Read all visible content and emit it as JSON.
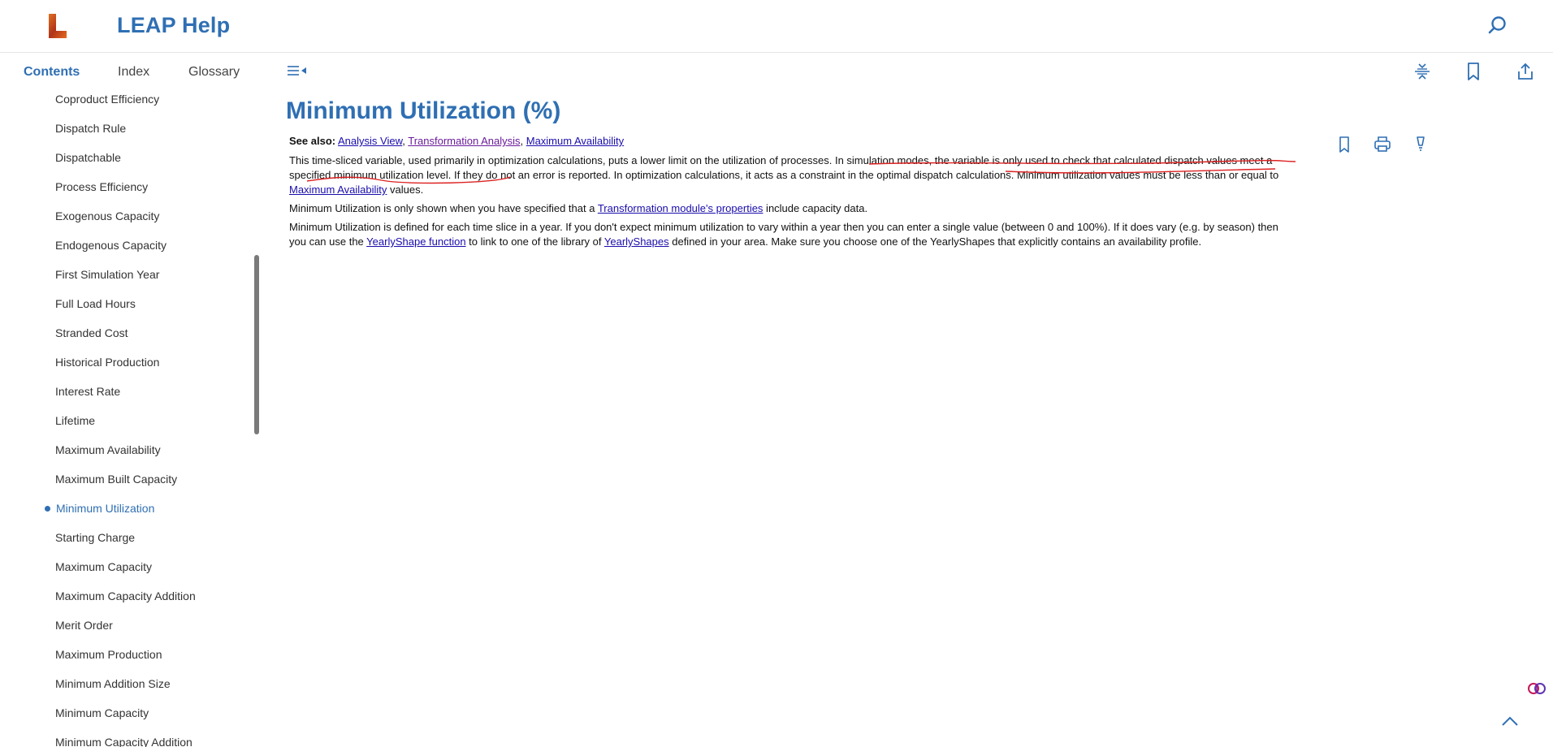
{
  "header": {
    "app_title": "LEAP Help",
    "logo_icon": "leap-logo",
    "search_icon": "search-icon",
    "accent_color": "#2f6fb3"
  },
  "tabs": [
    {
      "label": "Contents",
      "active": true
    },
    {
      "label": "Index",
      "active": false
    },
    {
      "label": "Glossary",
      "active": false
    }
  ],
  "toolbar": {
    "collapse_icon": "sidebar-collapse-icon",
    "icons": [
      "collapse-sections-icon",
      "bookmark-icon",
      "share-icon"
    ]
  },
  "sidebar": {
    "items": [
      {
        "label": "Coproduct Efficiency",
        "active": false
      },
      {
        "label": "Dispatch Rule",
        "active": false
      },
      {
        "label": "Dispatchable",
        "active": false
      },
      {
        "label": "Process Efficiency",
        "active": false
      },
      {
        "label": "Exogenous Capacity",
        "active": false
      },
      {
        "label": "Endogenous Capacity",
        "active": false
      },
      {
        "label": "First Simulation Year",
        "active": false
      },
      {
        "label": "Full Load Hours",
        "active": false
      },
      {
        "label": "Stranded Cost",
        "active": false
      },
      {
        "label": "Historical Production",
        "active": false
      },
      {
        "label": "Interest Rate",
        "active": false
      },
      {
        "label": "Lifetime",
        "active": false
      },
      {
        "label": "Maximum Availability",
        "active": false
      },
      {
        "label": "Maximum Built Capacity",
        "active": false
      },
      {
        "label": "Minimum Utilization",
        "active": true
      },
      {
        "label": "Starting Charge",
        "active": false
      },
      {
        "label": "Maximum Capacity",
        "active": false
      },
      {
        "label": "Maximum Capacity Addition",
        "active": false
      },
      {
        "label": "Merit Order",
        "active": false
      },
      {
        "label": "Maximum Production",
        "active": false
      },
      {
        "label": "Minimum Addition Size",
        "active": false
      },
      {
        "label": "Minimum Capacity",
        "active": false
      },
      {
        "label": "Minimum Capacity Addition",
        "active": false
      }
    ]
  },
  "main": {
    "title": "Minimum Utilization (%)",
    "see_also_label": "See also:",
    "see_also_links": [
      "Analysis View",
      "Transformation Analysis",
      "Maximum Availability"
    ],
    "p1": {
      "a": "This time-sliced variable, used primarily in optimization calculations, puts a lower limit on the utilization of processes.   ",
      "highlight": "In simulation modes, the variable is only used to check that calculated dispatch values meet a specified minimum utilization level.",
      "b": "  If they do not an error is reported. In optimization calculations, it acts as a constraint in the optimal dispatch calculations.  Minimum utilization values must be less than or equal to ",
      "link": "Maximum Availability",
      "c": " values."
    },
    "p2": {
      "a": "Minimum Utilization is only shown when you have specified that a ",
      "link": "Transformation module's properties",
      "b": " include capacity data."
    },
    "p3": {
      "a": "Minimum Utilization is defined for each time slice in a year.  If you don't expect minimum utilization to vary within a year then you can enter a single value (between 0 and 100%).  If it does vary (e.g. by season) then you can use the ",
      "link1": "YearlyShape function",
      "b": " to link to one of the library of ",
      "link2": "YearlyShapes",
      "c": " defined in your area.  Make sure you choose one of the YearlyShapes that explicitly contains an availability profile."
    },
    "content_icons": [
      "bookmark-icon",
      "print-icon",
      "lightbulb-icon"
    ]
  },
  "floating": {
    "brain_icon": "ai-assistant-icon",
    "top_icon": "scroll-to-top-icon"
  }
}
